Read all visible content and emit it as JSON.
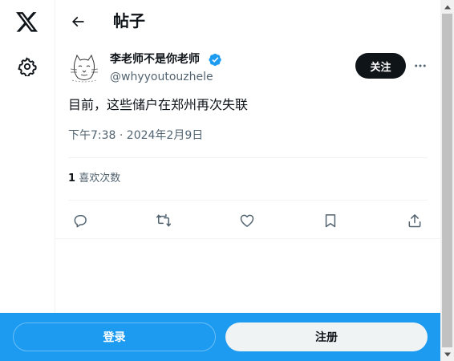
{
  "nav": {
    "logo_icon": "x-logo-icon",
    "settings_icon": "gear-icon"
  },
  "header": {
    "back_icon": "arrow-left-icon",
    "title": "帖子"
  },
  "post": {
    "author": {
      "name": "李老师不是你老师",
      "handle": "@whyyoutouzhele",
      "verified": true,
      "verified_color": "#1d9bf0"
    },
    "follow_label": "关注",
    "more_icon": "ellipsis-icon",
    "text": "目前，这些储户在郑州再次失联",
    "meta": "下午7:38 · 2024年2月9日",
    "likes": {
      "count": "1",
      "label": "喜欢次数"
    },
    "actions": [
      {
        "name": "reply",
        "icon": "reply-icon"
      },
      {
        "name": "repost",
        "icon": "repost-icon"
      },
      {
        "name": "like",
        "icon": "heart-icon"
      },
      {
        "name": "bookmark",
        "icon": "bookmark-icon"
      },
      {
        "name": "share",
        "icon": "share-icon"
      }
    ]
  },
  "bottom_bar": {
    "login_label": "登录",
    "signup_label": "注册",
    "background": "#1d9bf0"
  },
  "colors": {
    "text_primary": "#0f1419",
    "text_secondary": "#536471",
    "divider": "#eff3f4",
    "accent": "#1d9bf0"
  }
}
